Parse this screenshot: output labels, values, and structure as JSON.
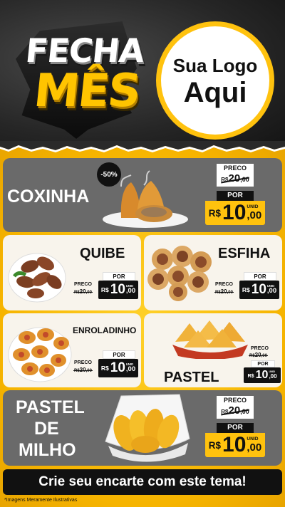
{
  "header": {
    "title_line1": "FECHA",
    "title_line2": "MÊS",
    "logo_line1": "Sua Logo",
    "logo_line2": "Aqui"
  },
  "products": {
    "coxinha": {
      "name": "COXINHA",
      "badge": "-50%",
      "preco_label": "PRECO",
      "old_currency": "R$",
      "old_price": "20",
      "old_cents": ",00",
      "por_label": "POR",
      "currency": "R$",
      "price": "10",
      "cents": ",00",
      "unit": "UNID"
    },
    "quibe": {
      "name": "QUIBE",
      "preco_label": "PRECO",
      "old_currency": "R$",
      "old_price": "20",
      "old_cents": ",00",
      "por_label": "POR",
      "currency": "R$",
      "price": "10",
      "cents": ",00",
      "unit": "UNID"
    },
    "esfiha": {
      "name": "ESFIHA",
      "preco_label": "PRECO",
      "old_currency": "R$",
      "old_price": "20",
      "old_cents": ",00",
      "por_label": "POR",
      "currency": "R$",
      "price": "10",
      "cents": ",00",
      "unit": "UNID"
    },
    "enroladinho": {
      "name": "ENROLADINHO",
      "preco_label": "PRECO",
      "old_currency": "R$",
      "old_price": "20",
      "old_cents": ",00",
      "por_label": "POR",
      "currency": "R$",
      "price": "10",
      "cents": ",00",
      "unit": "UNID"
    },
    "pastel": {
      "name": "PASTEL",
      "preco_label": "PRECO",
      "old_currency": "R$",
      "old_price": "20",
      "old_cents": ",00",
      "por_label": "POR",
      "currency": "R$",
      "price": "10",
      "cents": ",00",
      "unit": "UNID"
    },
    "pastel_milho": {
      "name_line1": "PASTEL",
      "name_line2": "DE",
      "name_line3": "MILHO",
      "preco_label": "PRECO",
      "old_currency": "R$",
      "old_price": "20",
      "old_cents": ",00",
      "por_label": "POR",
      "currency": "R$",
      "price": "10",
      "cents": ",00",
      "unit": "UNID"
    }
  },
  "footer": {
    "cta": "Crie seu encarte com este tema!",
    "disclaimer": "*Imagens Meramente Ilustrativas"
  },
  "colors": {
    "accent_yellow": "#ffc20e",
    "dark_card": "#6a6a6a",
    "light_card": "#f8f4ec",
    "black": "#111111"
  }
}
